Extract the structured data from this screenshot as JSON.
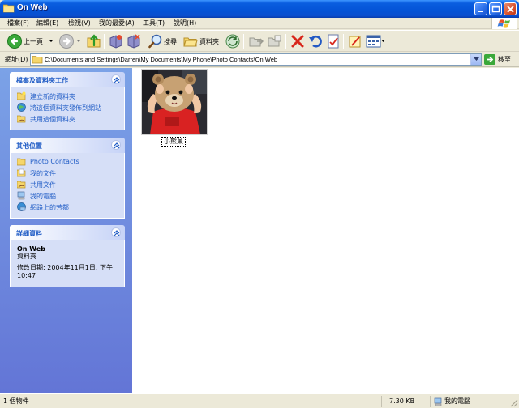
{
  "window": {
    "title": "On Web"
  },
  "menu": [
    {
      "label": "檔案(F)"
    },
    {
      "label": "編輯(E)"
    },
    {
      "label": "檢視(V)"
    },
    {
      "label": "我的最愛(A)"
    },
    {
      "label": "工具(T)"
    },
    {
      "label": "說明(H)"
    }
  ],
  "toolbar": {
    "back_label": "上一頁",
    "search_label": "搜尋",
    "folders_label": "資料夾"
  },
  "address": {
    "label": "網址(D)",
    "path": "C:\\Documents and Settings\\Darren\\My Documents\\My Phone\\Photo Contacts\\On Web",
    "go_label": "移至"
  },
  "taskpane": {
    "file_tasks": {
      "title": "檔案及資料夾工作",
      "items": [
        {
          "label": "建立新的資料夾",
          "icon": "new-folder-icon"
        },
        {
          "label": "將這個資料夾發佈到網站",
          "icon": "publish-web-icon"
        },
        {
          "label": "共用這個資料夾",
          "icon": "share-folder-icon"
        }
      ]
    },
    "other_places": {
      "title": "其他位置",
      "items": [
        {
          "label": "Photo Contacts",
          "icon": "folder-icon"
        },
        {
          "label": "我的文件",
          "icon": "my-documents-icon"
        },
        {
          "label": "共用文件",
          "icon": "shared-documents-icon"
        },
        {
          "label": "我的電腦",
          "icon": "my-computer-icon"
        },
        {
          "label": "網路上的芳鄰",
          "icon": "network-places-icon"
        }
      ]
    },
    "details": {
      "title": "詳細資料",
      "name": "On Web",
      "type": "資料夾",
      "modified_line1": "修改日期: 2004年11月1日, 下午",
      "modified_line2": "10:47"
    }
  },
  "files": [
    {
      "name": "小熊菓"
    }
  ],
  "status": {
    "count": "1 個物件",
    "size": "7.30 KB",
    "location": "我的電腦"
  },
  "colors": {
    "title_blue": "#0453d6",
    "task_link": "#215dc6",
    "pane_gradient_top": "#7ba2e7",
    "pane_gradient_bottom": "#6375d6"
  }
}
